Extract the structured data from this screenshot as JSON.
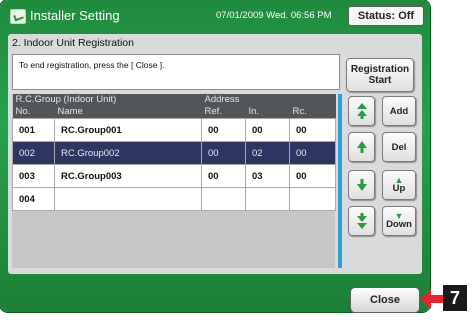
{
  "window": {
    "title": "Installer Setting",
    "datetime": "07/01/2009 Wed. 06:56 PM",
    "status": "Status: Off"
  },
  "section": {
    "title": "2. Indoor Unit Registration",
    "message": "To end registration, press the [ Close ]."
  },
  "buttons": {
    "registration_start_line1": "Registration",
    "registration_start_line2": "Start",
    "add": "Add",
    "del": "Del",
    "up": "Up",
    "down": "Down",
    "close": "Close"
  },
  "table": {
    "group_header": "R.C.Group (Indoor Unit)",
    "address_header": "Address",
    "columns": [
      "No.",
      "Name",
      "Ref.",
      "In.",
      "Rc."
    ],
    "rows": [
      {
        "no": "001",
        "name": "RC.Group001",
        "ref": "00",
        "in": "00",
        "rc": "00",
        "selected": false
      },
      {
        "no": "002",
        "name": "RC.Group002",
        "ref": "00",
        "in": "02",
        "rc": "00",
        "selected": true
      },
      {
        "no": "003",
        "name": "RC.Group003",
        "ref": "00",
        "in": "03",
        "rc": "00",
        "selected": false
      },
      {
        "no": "004",
        "name": "",
        "ref": "",
        "in": "",
        "rc": "",
        "selected": false
      }
    ]
  },
  "callout": {
    "number": "7"
  },
  "colors": {
    "frame_green": "#2aa14c",
    "selected_row": "#2d3560",
    "callout_red": "#e2262b"
  }
}
